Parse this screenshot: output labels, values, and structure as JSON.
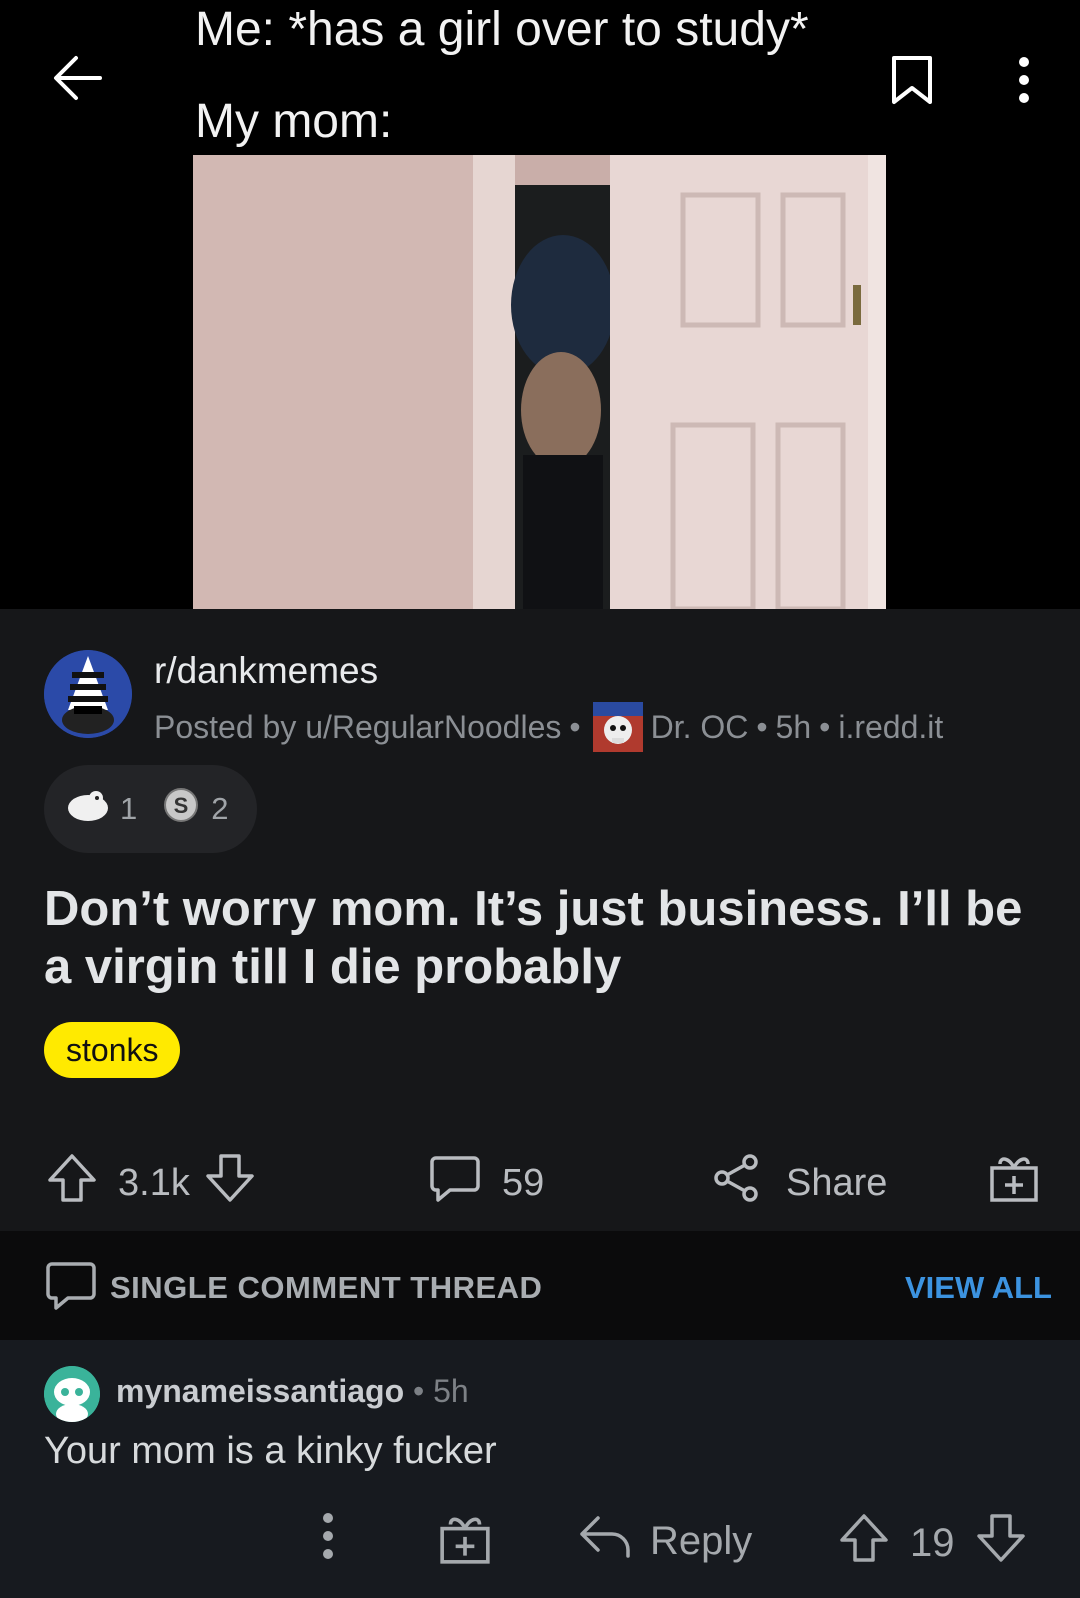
{
  "media": {
    "caption_line1": "Me: *has a girl over to study*",
    "caption_line2": "My mom:"
  },
  "toolbar": {
    "back_icon": "arrow-left-icon",
    "save_icon": "bookmark-icon",
    "more_icon": "more-vertical-icon"
  },
  "post": {
    "subreddit": "r/dankmemes",
    "posted_by_prefix": "Posted by",
    "author": "u/RegularNoodles",
    "author_flair": "Dr. OC",
    "age": "5h",
    "domain": "i.redd.it",
    "awards": [
      {
        "icon": "award-icon",
        "count": "1"
      },
      {
        "icon": "silver-award-icon",
        "count": "2"
      }
    ],
    "title": "Don’t worry mom. It’s just business. I’ll be a virgin till I die probably",
    "flair": "stonks",
    "score": "3.1k",
    "comments": "59",
    "share_label": "Share"
  },
  "thread": {
    "label": "SINGLE COMMENT THREAD",
    "view_all": "VIEW ALL"
  },
  "comment": {
    "author": "mynameissantiago",
    "age": "5h",
    "body": "Your mom is a kinky fucker",
    "reply_label": "Reply",
    "score": "19"
  },
  "colors": {
    "background": "#111214",
    "flair_yellow": "#ffea00",
    "link_blue": "#3c93e0"
  }
}
